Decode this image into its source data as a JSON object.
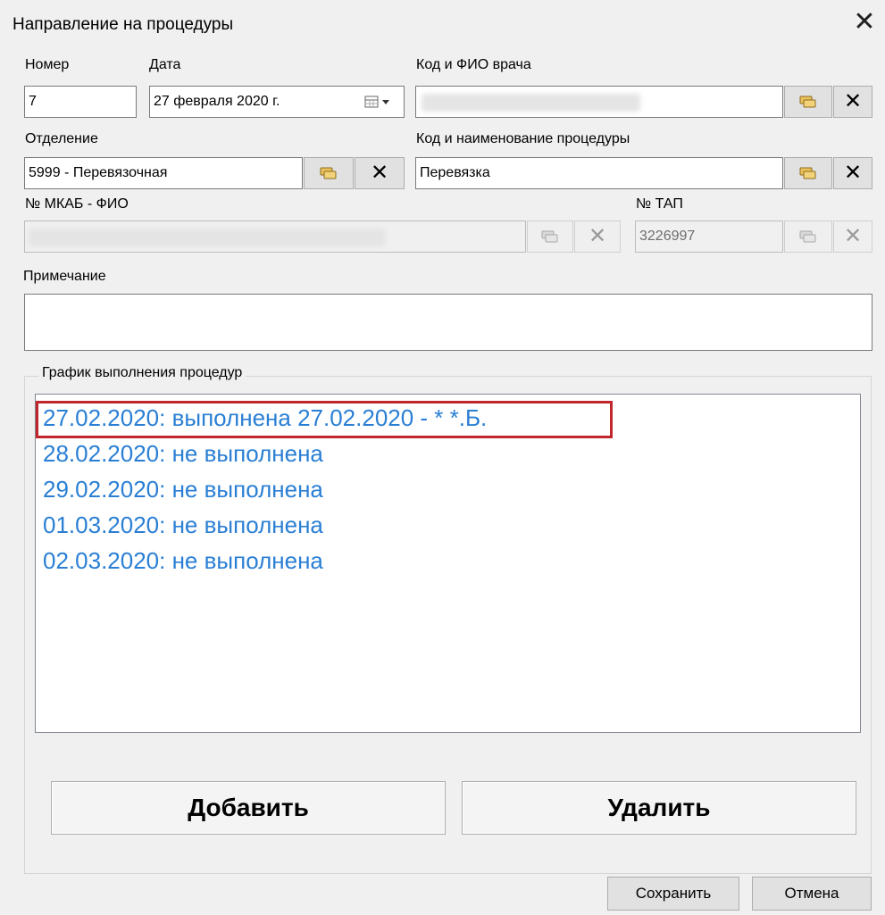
{
  "window": {
    "title": "Направление на процедуры",
    "close_label": "✕"
  },
  "form": {
    "number": {
      "label": "Номер",
      "value": "7"
    },
    "date": {
      "label": "Дата",
      "value": "27 февраля  2020 г."
    },
    "doctor": {
      "label": "Код и ФИО врача",
      "value": ""
    },
    "department": {
      "label": "Отделение",
      "value": "5999 - Перевязочная"
    },
    "procedure": {
      "label": "Код и наименование процедуры",
      "value": "Перевязка"
    },
    "mkab": {
      "label": "№ МКАБ - ФИО",
      "value": ""
    },
    "tap": {
      "label": "№ ТАП",
      "value": "3226997"
    },
    "note": {
      "label": "Примечание",
      "value": ""
    }
  },
  "schedule": {
    "title": "График выполнения процедур",
    "items": [
      "27.02.2020: выполнена 27.02.2020 - * *.Б.",
      "28.02.2020: не выполнена",
      "29.02.2020: не выполнена",
      "01.03.2020: не выполнена",
      "02.03.2020: не выполнена"
    ],
    "item_color": "#2a7fd4",
    "highlight_color": "#c0262c",
    "add_label": "Добавить",
    "delete_label": "Удалить"
  },
  "footer": {
    "save_label": "Сохранить",
    "cancel_label": "Отмена"
  },
  "icons": {
    "select": "select-records-icon",
    "clear": "clear-x-icon",
    "calendar": "calendar-dropdown-icon"
  }
}
